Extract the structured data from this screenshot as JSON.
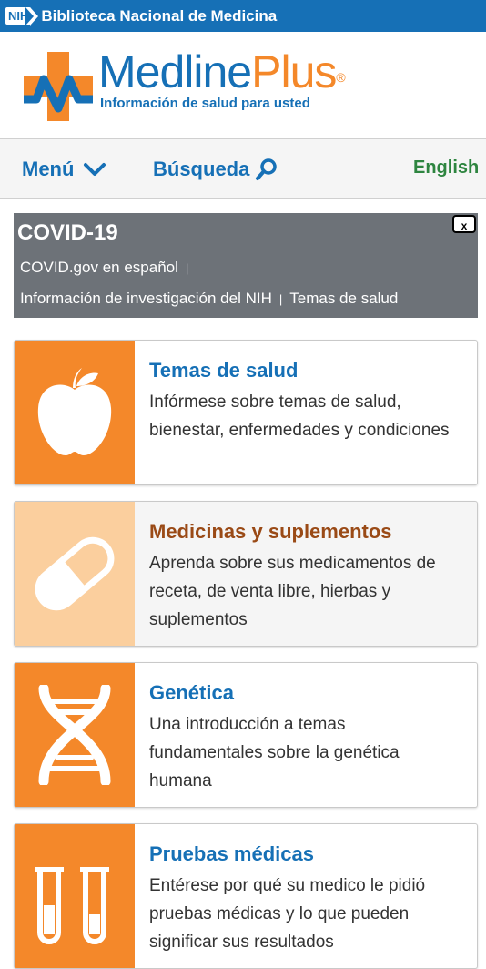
{
  "nih_bar": {
    "badge": "NIH",
    "title": "Biblioteca Nacional de Medicina"
  },
  "header": {
    "logo_name_a": "Medline",
    "logo_name_b": "Plus",
    "logo_reg": "®",
    "tagline": "Información de salud para usted"
  },
  "nav": {
    "menu": "Menú",
    "search": "Búsqueda",
    "english": "English"
  },
  "covid": {
    "title": "COVID-19",
    "close": "x",
    "links": [
      "COVID.gov en español",
      "Información de investigación del NIH",
      "Temas de salud"
    ],
    "separator": "|"
  },
  "cards": [
    {
      "title": "Temas de salud",
      "desc": "Infórmese sobre temas de salud, bienestar, enfermedades y condiciones",
      "icon": "apple-icon",
      "title_color": "#1670b6",
      "icon_bg": "#f4882a"
    },
    {
      "title": "Medicinas y suplementos",
      "desc": "Aprenda sobre sus medicamentos de receta, de venta libre, hierbas y suplementos",
      "icon": "pill-icon",
      "title_color": "#9a4a16",
      "icon_bg": "#fbcf9e"
    },
    {
      "title": "Genética",
      "desc": "Una introducción a temas fundamentales sobre la genética humana",
      "icon": "dna-icon",
      "title_color": "#1670b6",
      "icon_bg": "#f4882a"
    },
    {
      "title": "Pruebas médicas",
      "desc": "Entérese por qué su medico le pidió pruebas médicas y lo que pueden significar sus resultados",
      "icon": "test-tubes-icon",
      "title_color": "#1670b6",
      "icon_bg": "#f4882a"
    }
  ]
}
